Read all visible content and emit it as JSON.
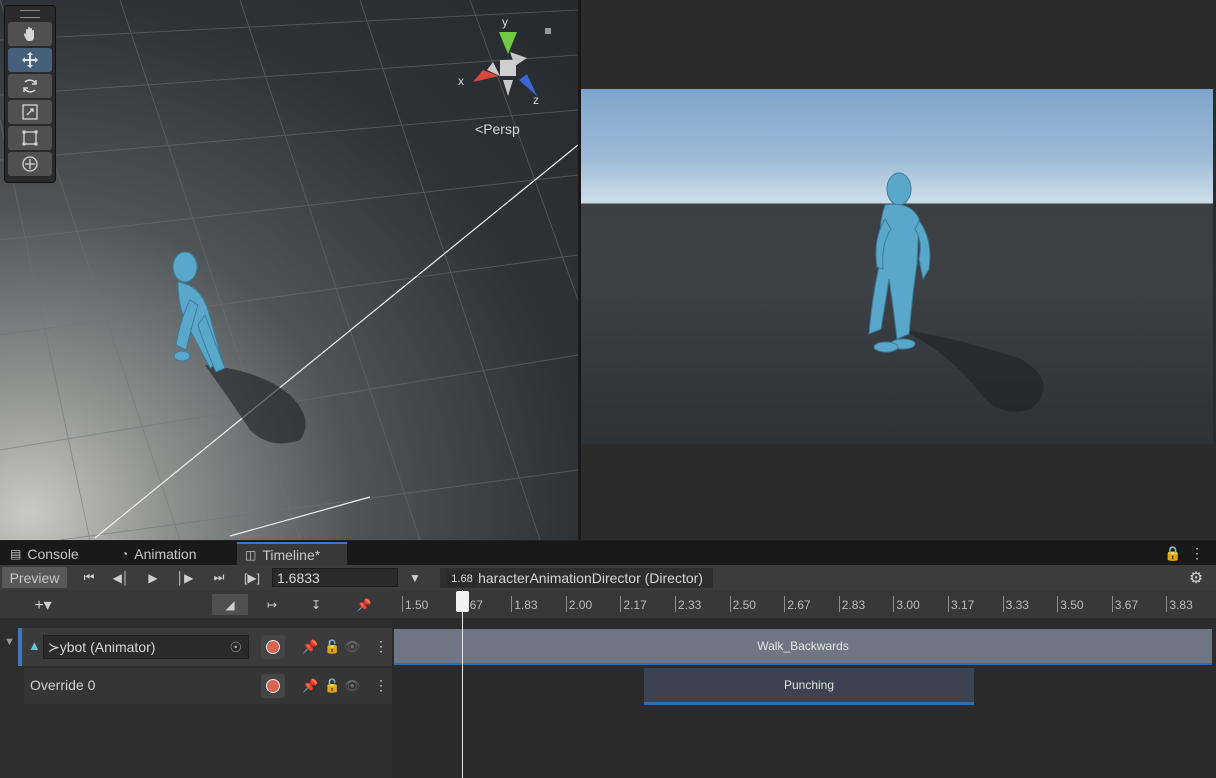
{
  "scene_view": {
    "gizmo_axes": {
      "x": "x",
      "y": "y",
      "z": "z"
    },
    "projection_label": "Persp",
    "tools": [
      {
        "name": "hand-tool-icon"
      },
      {
        "name": "move-tool-icon",
        "active": true
      },
      {
        "name": "rotate-tool-icon"
      },
      {
        "name": "scale-tool-icon"
      },
      {
        "name": "rect-tool-icon"
      },
      {
        "name": "transform-tool-icon"
      }
    ]
  },
  "tabs": [
    {
      "label": "Console",
      "icon": "console-icon"
    },
    {
      "label": "Animation",
      "icon": "animation-icon"
    },
    {
      "label": "Timeline*",
      "icon": "timeline-icon",
      "active": true
    }
  ],
  "timeline": {
    "preview_label": "Preview",
    "time_value": "1.6833",
    "director_label": "CharacterAnimationDirector (Director)",
    "playhead_label": "1.68",
    "ruler_ticks": [
      "1.50",
      "1.67",
      "1.83",
      "2.00",
      "2.17",
      "2.33",
      "2.50",
      "2.67",
      "2.83",
      "3.00",
      "3.17",
      "3.33",
      "3.50",
      "3.67",
      "3.83"
    ],
    "tracks": [
      {
        "name": "ybot (Animator)",
        "clip": "Walk_Backwards"
      },
      {
        "name": "Override 0",
        "clip": "Punching"
      }
    ]
  },
  "colors": {
    "accent": "#3a79bb",
    "record": "#d8634f",
    "clip": "#6f7583"
  }
}
